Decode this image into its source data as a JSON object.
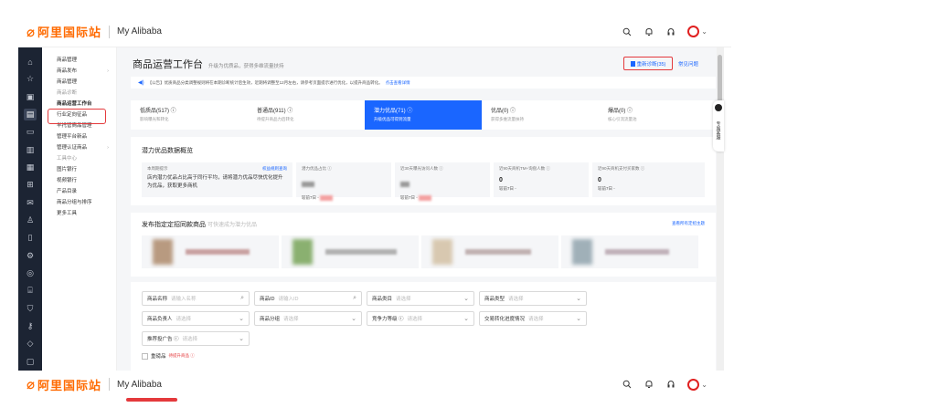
{
  "brand": {
    "logo_text": "阿里国际站",
    "site_name": "My Alibaba"
  },
  "topbar_icons": [
    "search-icon",
    "bell-icon",
    "headset-icon",
    "avatar"
  ],
  "rail_icons": [
    "home-icon",
    "star-icon",
    "box-icon",
    "shop-icon",
    "video-icon",
    "chart-icon",
    "doc-icon",
    "grid-icon",
    "mail-icon",
    "user-icon",
    "file-icon",
    "settings-icon",
    "compass-icon",
    "store-icon",
    "shield-icon",
    "key-icon",
    "diamond-icon",
    "clipboard-icon"
  ],
  "sidebar": {
    "items": [
      {
        "label": "商品管理",
        "type": "header"
      },
      {
        "label": "商品发布",
        "type": "item",
        "arrow": "›"
      },
      {
        "label": "商品管理",
        "type": "item"
      },
      {
        "label": "商品诊断",
        "type": "group"
      },
      {
        "label": "商品运营工作台",
        "type": "selected"
      },
      {
        "label": "行业定向征品",
        "type": "item"
      },
      {
        "label": "半托管商品管理",
        "type": "item"
      },
      {
        "label": "管理平台新品",
        "type": "item"
      },
      {
        "label": "管理认证商品",
        "type": "item",
        "arrow": "›"
      },
      {
        "label": "工具中心",
        "type": "group"
      },
      {
        "label": "图片银行",
        "type": "item"
      },
      {
        "label": "视频银行",
        "type": "item"
      },
      {
        "label": "产品目录",
        "type": "item"
      },
      {
        "label": "商品分组与排序",
        "type": "item"
      },
      {
        "label": "更多工具",
        "type": "item"
      }
    ]
  },
  "main": {
    "title": "商品运营工作台",
    "subtitle": "升级为优质品，获得多维流量扶持",
    "diag_button": "重新诊断(35)",
    "faq_link": "常见问题",
    "notice": {
      "icon": "speaker-icon",
      "text": "【公告】优质商品分类调整规则将在本期诊断统计后生效，近期将调整至12月左右，请参考页面提示进行优化，以提升商品转化。",
      "link": "点击查看详情"
    },
    "tabs": [
      {
        "label": "低质品(517) ⓘ",
        "desc": "影响曝光和转化"
      },
      {
        "label": "普通品(911) ⓘ",
        "desc": "待提升商品力后转化"
      },
      {
        "label": "潜力优品(71) ⓘ",
        "desc": "升级优品可得到流量",
        "active": true
      },
      {
        "label": "优品(0) ⓘ",
        "desc": "获得多维流量扶持"
      },
      {
        "label": "爆品(0) ⓘ",
        "desc": "核心引流流量池"
      }
    ],
    "potential": {
      "title": "潜力优品数据概览",
      "tip_label": "本周期提示",
      "tip_link": "权益规则查询",
      "tip_text": "店内潜力优品占比高于同行平均，请将潜力优品尽快优化提升为优品，获取更多商机",
      "metrics": [
        {
          "label": "潜力优品占比 ⓘ",
          "value": "",
          "compare": "较前7日 -"
        },
        {
          "label": "近30天曝光访问人数 ⓘ",
          "value": "",
          "compare": "较前7日 -"
        },
        {
          "label": "近90天商机TM+询盘人数 ⓘ",
          "value": "0",
          "compare": "较前7日 -"
        },
        {
          "label": "近90天商机支付买家数 ⓘ",
          "value": "0",
          "compare": "较前7日 -"
        }
      ]
    },
    "publish": {
      "title": "发布指定定招同款商品",
      "hint": "可快速成为潜力优品",
      "link": "查看所有定招主题"
    },
    "filters": [
      {
        "label": "商品名称",
        "placeholder": "请输入名称",
        "icon": "search-icon"
      },
      {
        "label": "商品ID",
        "placeholder": "请输入ID",
        "icon": "search-icon"
      },
      {
        "label": "商品类目",
        "placeholder": "请选择",
        "icon": "chevron-down-icon"
      },
      {
        "label": "商品类型",
        "placeholder": "请选择",
        "icon": "chevron-down-icon"
      },
      {
        "label": "商品负责人",
        "placeholder": "请选择",
        "icon": "chevron-down-icon"
      },
      {
        "label": "商品分组",
        "placeholder": "请选择",
        "icon": "chevron-down-icon"
      },
      {
        "label": "竞争力等级 ⓘ",
        "placeholder": "请选择",
        "icon": "chevron-down-icon"
      },
      {
        "label": "交易转化进度情况",
        "placeholder": "请选择",
        "icon": "chevron-down-icon"
      },
      {
        "label": "推荐投广告 ⓘ",
        "placeholder": "请选择",
        "icon": "chevron-down-icon"
      }
    ],
    "checkbox": {
      "label": "重磅品",
      "tag": "待提升商品 ⓘ"
    }
  },
  "float_help": "专属客服",
  "colors": {
    "accent": "#1a66ff",
    "brand": "#ff6a00",
    "highlight": "#e4393c",
    "rail": "#1c2433"
  }
}
